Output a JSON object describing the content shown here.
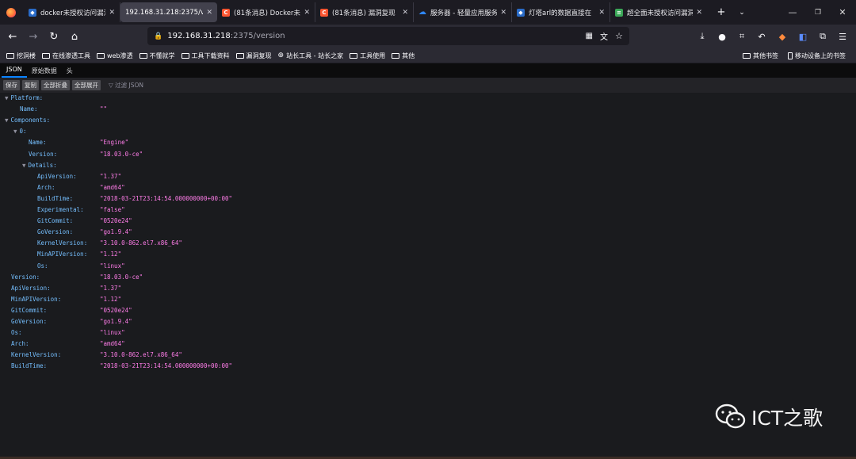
{
  "tabs": [
    {
      "title": "docker未授权访问漏洞",
      "icon": "docker-icon",
      "icon_color": "#2a6cc9"
    },
    {
      "title": "192.168.31.218:2375/ver",
      "icon": "",
      "active": true
    },
    {
      "title": "(81条消息) Docker未",
      "icon": "csdn-icon",
      "icon_color": "#fc5531"
    },
    {
      "title": "(81条消息) 漏洞复现",
      "icon": "csdn-icon",
      "icon_color": "#fc5531"
    },
    {
      "title": "服务器 - 轻量应用服务",
      "icon": "cloud-icon",
      "icon_color": "#2f86f6"
    },
    {
      "title": "灯塔arl的数据直接在",
      "icon": "docker-icon",
      "icon_color": "#2a6cc9"
    },
    {
      "title": "超全面未授权访问漏洞",
      "icon": "green-doc-icon",
      "icon_color": "#3aa757"
    }
  ],
  "url": {
    "host": "192.168.31.218",
    "rest": ":2375/version"
  },
  "bookmarks": [
    "挖洞楼",
    "在线渗透工具",
    "web渗透",
    "不懂就学",
    "工具下载资料",
    "漏洞复现",
    "站长工具 - 站长之家",
    "工具使用",
    "其他"
  ],
  "bookmarks_right": [
    "其他书签",
    "移动设备上的书签"
  ],
  "viewer_tabs": [
    "JSON",
    "原始数据",
    "头"
  ],
  "toolbar": {
    "save": "保存",
    "copy": "复制",
    "collapse_all": "全部折叠",
    "expand_all": "全部展开",
    "filter": "过滤 JSON"
  },
  "json_rows": [
    {
      "indent": 0,
      "twisty": "▼",
      "key": "Platform:",
      "value": ""
    },
    {
      "indent": 1,
      "twisty": "",
      "key": "Name:",
      "value": "\"\""
    },
    {
      "indent": 0,
      "twisty": "▼",
      "key": "Components:",
      "value": ""
    },
    {
      "indent": 1,
      "twisty": "▼",
      "key": "0:",
      "value": ""
    },
    {
      "indent": 2,
      "twisty": "",
      "key": "Name:",
      "value": "\"Engine\""
    },
    {
      "indent": 2,
      "twisty": "",
      "key": "Version:",
      "value": "\"18.03.0-ce\""
    },
    {
      "indent": 2,
      "twisty": "▼",
      "key": "Details:",
      "value": ""
    },
    {
      "indent": 3,
      "twisty": "",
      "key": "ApiVersion:",
      "value": "\"1.37\""
    },
    {
      "indent": 3,
      "twisty": "",
      "key": "Arch:",
      "value": "\"amd64\""
    },
    {
      "indent": 3,
      "twisty": "",
      "key": "BuildTime:",
      "value": "\"2018-03-21T23:14:54.000000000+00:00\""
    },
    {
      "indent": 3,
      "twisty": "",
      "key": "Experimental:",
      "value": "\"false\""
    },
    {
      "indent": 3,
      "twisty": "",
      "key": "GitCommit:",
      "value": "\"0520e24\""
    },
    {
      "indent": 3,
      "twisty": "",
      "key": "GoVersion:",
      "value": "\"go1.9.4\""
    },
    {
      "indent": 3,
      "twisty": "",
      "key": "KernelVersion:",
      "value": "\"3.10.0-862.el7.x86_64\""
    },
    {
      "indent": 3,
      "twisty": "",
      "key": "MinAPIVersion:",
      "value": "\"1.12\""
    },
    {
      "indent": 3,
      "twisty": "",
      "key": "Os:",
      "value": "\"linux\""
    },
    {
      "indent": 0,
      "twisty": "",
      "key": "Version:",
      "value": "\"18.03.0-ce\""
    },
    {
      "indent": 0,
      "twisty": "",
      "key": "ApiVersion:",
      "value": "\"1.37\""
    },
    {
      "indent": 0,
      "twisty": "",
      "key": "MinAPIVersion:",
      "value": "\"1.12\""
    },
    {
      "indent": 0,
      "twisty": "",
      "key": "GitCommit:",
      "value": "\"0520e24\""
    },
    {
      "indent": 0,
      "twisty": "",
      "key": "GoVersion:",
      "value": "\"go1.9.4\""
    },
    {
      "indent": 0,
      "twisty": "",
      "key": "Os:",
      "value": "\"linux\""
    },
    {
      "indent": 0,
      "twisty": "",
      "key": "Arch:",
      "value": "\"amd64\""
    },
    {
      "indent": 0,
      "twisty": "",
      "key": "KernelVersion:",
      "value": "\"3.10.0-862.el7.x86_64\""
    },
    {
      "indent": 0,
      "twisty": "",
      "key": "BuildTime:",
      "value": "\"2018-03-21T23:14:54.000000000+00:00\""
    }
  ],
  "watermark": "ICT之歌",
  "colors": {
    "key": "#75bfff",
    "string": "#ff7de9",
    "accent": "#0a84ff"
  }
}
